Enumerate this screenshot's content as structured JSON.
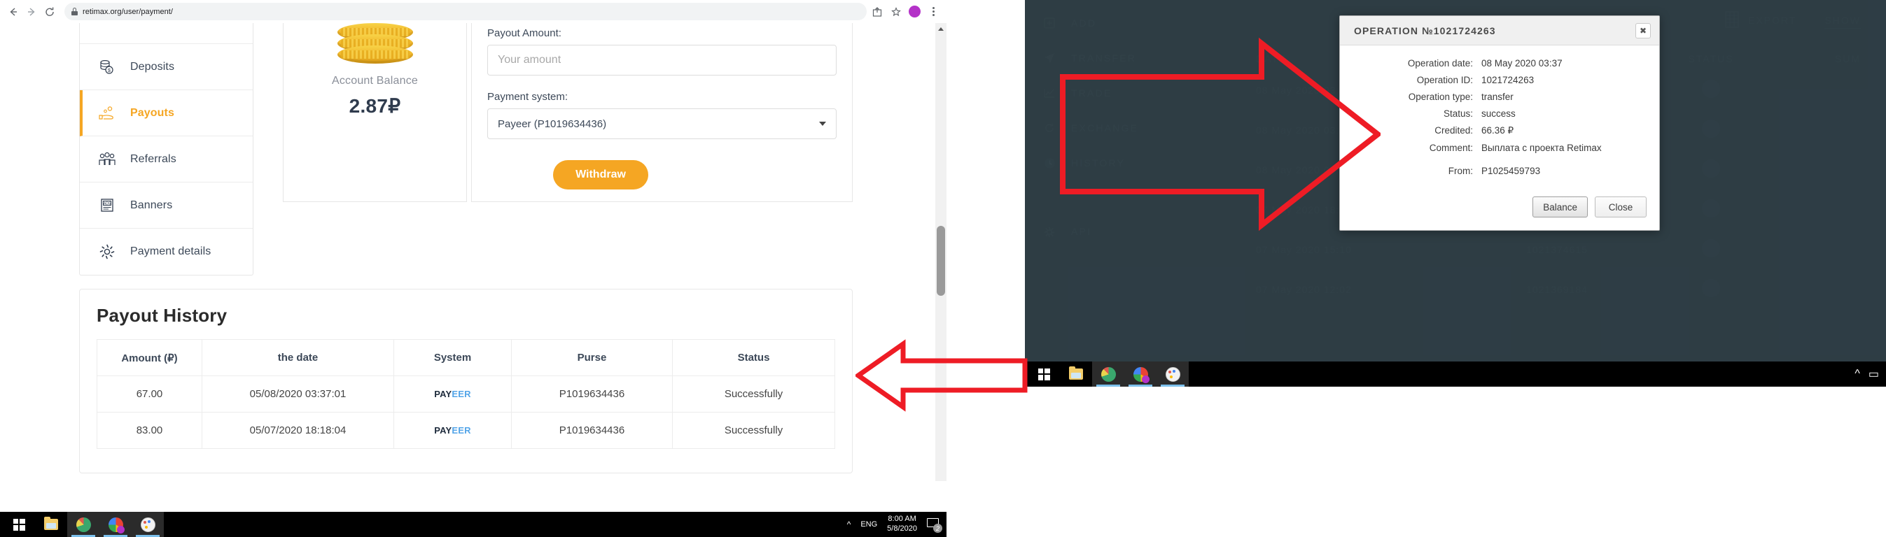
{
  "browser": {
    "url": "retimax.org/user/payment/",
    "back_icon": "back-arrow-icon",
    "forward_icon": "forward-arrow-icon",
    "reload_icon": "reload-icon",
    "lock_icon": "lock-icon",
    "share_icon": "share-icon",
    "star_icon": "star-icon",
    "avatar_letter": "",
    "menu_icon": "kebab-menu-icon"
  },
  "sidebar": {
    "items": [
      {
        "label": "Deposits",
        "icon": "coins-icon",
        "active": false
      },
      {
        "label": "Payouts",
        "icon": "hand-coin-icon",
        "active": true
      },
      {
        "label": "Referrals",
        "icon": "people-icon",
        "active": false
      },
      {
        "label": "Banners",
        "icon": "ads-banner-icon",
        "active": false
      },
      {
        "label": "Payment details",
        "icon": "gear-icon",
        "active": false
      }
    ]
  },
  "balance_card": {
    "label": "Account Balance",
    "amount": "2.87₽",
    "icon": "coin-stack-icon"
  },
  "payout_form": {
    "amount_label": "Payout Amount:",
    "amount_placeholder": "Your amount",
    "amount_value": "",
    "system_label": "Payment system:",
    "system_selected": "Payeer (P1019634436)",
    "withdraw_label": "Withdraw",
    "accent_color": "#f5a623"
  },
  "history": {
    "title": "Payout History",
    "columns": [
      "Amount (₽)",
      "the date",
      "System",
      "Purse",
      "Status"
    ],
    "rows": [
      {
        "amount": "67.00",
        "date": "05/08/2020 03:37:01",
        "system_pay": "PAY",
        "system_eer": "EER",
        "purse": "P1019634436",
        "status": "Successfully"
      },
      {
        "amount": "83.00",
        "date": "05/07/2020 18:18:04",
        "system_pay": "PAY",
        "system_eer": "EER",
        "purse": "P1019634436",
        "status": "Successfully"
      }
    ]
  },
  "taskbar_left": {
    "start_icon": "windows-start-icon",
    "explorer_icon": "file-explorer-icon",
    "app3_icon": "lightshot-icon",
    "app4_icon": "chrome-icon",
    "app5_icon": "paint-icon",
    "chevron_icon": "show-hidden-icons-chevron",
    "language": "ENG",
    "time": "8:00 AM",
    "date": "5/8/2020",
    "notification_count": "2"
  },
  "payeer": {
    "nav_items": [
      {
        "label": "ADD",
        "icon": "plus-square-icon"
      },
      {
        "label": "TRANSFER",
        "icon": "send-icon"
      },
      {
        "label": "TRADE",
        "icon": "chart-icon"
      },
      {
        "label": "EXCHANGE",
        "icon": "exchange-icon"
      },
      {
        "label": "HISTORY",
        "icon": "clock-icon"
      },
      {
        "label": "API",
        "icon": "gear-api-icon"
      }
    ],
    "export_label": "EXPORT",
    "export_icon": "spreadsheet-icon",
    "show_label": "SHOW",
    "table_headers": [
      "DATE",
      "ID",
      "STATUS",
      "SUM"
    ],
    "rows": [
      {
        "date": "08 May 2020 03:41",
        "id": "1021725846",
        "status": "✓",
        "sum": ""
      },
      {
        "date": "08 May 2020 03:37",
        "id": "1021724263",
        "status": "✓",
        "sum": ""
      },
      {
        "date": "08 May 2020 03:33",
        "id": "1021723889",
        "status": "✓",
        "sum": ""
      },
      {
        "date": "07 May 2020 18:22",
        "id": "1021386917",
        "status": "✓",
        "sum": ""
      },
      {
        "date": "07 May 2020 15:10",
        "id": "1021374615",
        "status": "✓",
        "sum": ""
      },
      {
        "date": "07 May 2020 12:02",
        "id": "1021369184",
        "status": "✓",
        "sum": ""
      }
    ]
  },
  "modal": {
    "title": "OPERATION №1021724263",
    "close_icon": "close-icon",
    "fields": [
      {
        "key": "Operation date:",
        "value": "08 May 2020 03:37"
      },
      {
        "key": "Operation ID:",
        "value": "1021724263"
      },
      {
        "key": "Operation type:",
        "value": "transfer"
      },
      {
        "key": "Status:",
        "value": "success"
      },
      {
        "key": "Credited:",
        "value": "66.36 ₽"
      },
      {
        "key": "Comment:",
        "value": "Выплата с проекта Retimax"
      }
    ],
    "from_key": "From:",
    "from_value": "P1025459793",
    "balance_button": "Balance",
    "close_button": "Close"
  },
  "annotations": {
    "arrow_color": "#ee1c25",
    "arrow_left_name": "red-arrow-to-history-row",
    "arrow_right_name": "red-arrow-to-operation-dialog"
  }
}
